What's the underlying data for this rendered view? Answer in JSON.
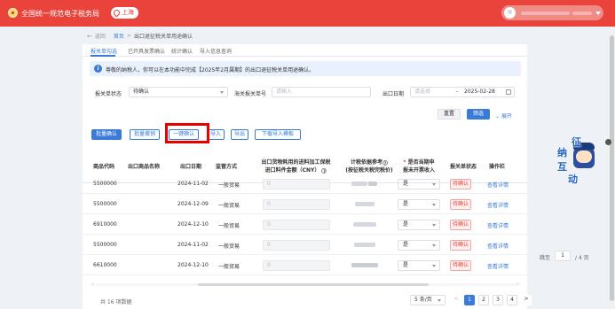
{
  "header": {
    "site_title": "全国统一规范电子税务局",
    "location": "上海"
  },
  "breadcrumb": {
    "back": "返回",
    "home": "首页",
    "separator": ">",
    "current": "出口退征税关单用途确认"
  },
  "tabs": [
    {
      "label": "报关单勾选",
      "active": true
    },
    {
      "label": "已开具发票确认",
      "active": false
    },
    {
      "label": "统计确认",
      "active": false
    },
    {
      "label": "导入信息查询",
      "active": false
    }
  ],
  "alert": {
    "text": "尊敬的纳税人，你可以在本功能中完成【2025年2月属期】的出口退征税关单用途确认。"
  },
  "filters": {
    "status_label": "报关单状态",
    "status_value": "待确认",
    "customs_no_label": "海关报关单号",
    "customs_no_placeholder": "请输入",
    "export_date_label": "出口日期",
    "date_start_placeholder": "请选择",
    "date_separator": "-",
    "date_end_value": "2025-02-28"
  },
  "actions": {
    "reset": "重置",
    "search": "筛选",
    "expand": "展开",
    "batch_confirm": "批量确认",
    "batch_revoke": "批量撤销",
    "one_click_confirm": "一键确认",
    "import": "导入",
    "export": "导出",
    "download_template": "下载导入模板"
  },
  "table": {
    "columns": {
      "code": "商品代码",
      "name": "出口商品名称",
      "date": "出口日期",
      "supervision": "监管方式",
      "amount_line1": "出口货物耗用的进料加工保税",
      "amount_line2": "进口料件金额（CNY）",
      "ref_line1": "计税依据参考",
      "ref_line2": "(按征税关税完税价)",
      "declare_line1": "是否当期申",
      "declare_line2": "报未开票收入",
      "status": "报关单状态",
      "ops": "操作栏"
    },
    "amount_placeholder": "0",
    "rows": [
      {
        "code": "5500000",
        "date": "2024-11-02",
        "supervision": "一般贸易",
        "declare": "是",
        "status": "待确认",
        "op": "查看详情"
      },
      {
        "code": "5500000",
        "date": "2024-12-09",
        "supervision": "一般贸易",
        "declare": "是",
        "status": "待确认",
        "op": "查看详情"
      },
      {
        "code": "6910000",
        "date": "2024-12-10",
        "supervision": "一般贸易",
        "declare": "是",
        "status": "待确认",
        "op": "查看详情"
      },
      {
        "code": "5500000",
        "date": "2024-11-02",
        "supervision": "一般贸易",
        "declare": "是",
        "status": "待确认",
        "op": "查看详情"
      },
      {
        "code": "6610000",
        "date": "2024-12-10",
        "supervision": "一般贸易",
        "declare": "是",
        "status": "待确认",
        "op": "查看详情"
      }
    ]
  },
  "pagination": {
    "total": "共 16 项数据",
    "page_size": "5 条/页",
    "prev": "<",
    "next": ">",
    "pages": [
      "1",
      "2",
      "3",
      "4"
    ],
    "current_page": "1",
    "jump_label": "跳至",
    "jump_value": "1",
    "total_pages": "/ 4 页"
  },
  "mascot": {
    "chars": [
      "纳",
      "征",
      "互",
      "动"
    ]
  },
  "colors": {
    "brand_red": "#e9433c",
    "primary_blue": "#3a7ad8",
    "highlight_red": "#e60000"
  }
}
